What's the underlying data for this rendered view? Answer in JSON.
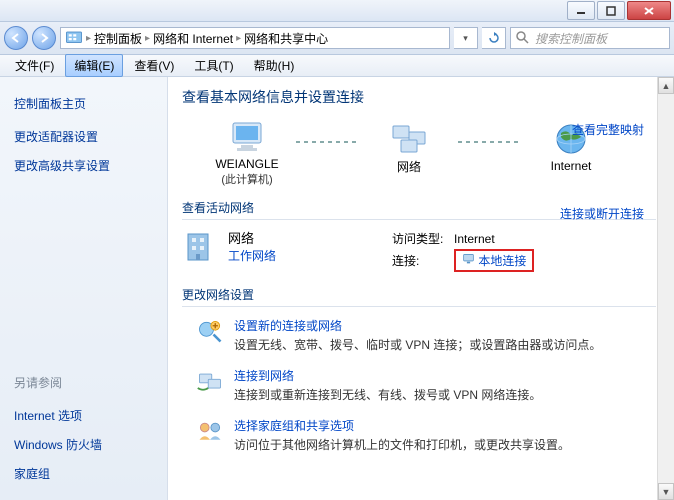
{
  "titlebar": {
    "min": "",
    "max": "",
    "close": ""
  },
  "nav": {
    "crumbs": [
      "控制面板",
      "网络和 Internet",
      "网络和共享中心"
    ],
    "search_placeholder": "搜索控制面板"
  },
  "menu": {
    "file": "文件(F)",
    "edit": "编辑(E)",
    "view": "查看(V)",
    "tools": "工具(T)",
    "help": "帮助(H)"
  },
  "sidebar": {
    "home": "控制面板主页",
    "adapter": "更改适配器设置",
    "advanced": "更改高级共享设置",
    "see_also": "另请参阅",
    "inet_options": "Internet 选项",
    "firewall": "Windows 防火墙",
    "homegroup": "家庭组"
  },
  "main": {
    "heading": "查看基本网络信息并设置连接",
    "full_map": "查看完整映射",
    "nodes": {
      "pc": "WEIANGLE",
      "pc_sub": "(此计算机)",
      "net": "网络",
      "internet": "Internet"
    },
    "active_head": "查看活动网络",
    "disconnect": "连接或断开连接",
    "active": {
      "name": "网络",
      "cat": "工作网络",
      "access_k": "访问类型:",
      "access_v": "Internet",
      "conn_k": "连接:",
      "conn_v": "本地连接"
    },
    "settings_head": "更改网络设置",
    "settings": [
      {
        "title": "设置新的连接或网络",
        "desc": "设置无线、宽带、拨号、临时或 VPN 连接；或设置路由器或访问点。"
      },
      {
        "title": "连接到网络",
        "desc": "连接到或重新连接到无线、有线、拨号或 VPN 网络连接。"
      },
      {
        "title": "选择家庭组和共享选项",
        "desc": "访问位于其他网络计算机上的文件和打印机，或更改共享设置。"
      }
    ]
  }
}
